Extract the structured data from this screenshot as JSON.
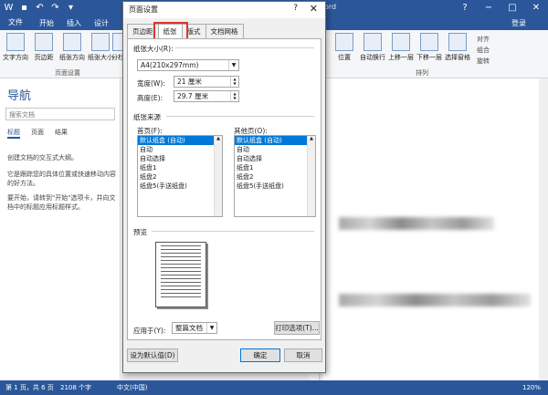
{
  "titlebar": {
    "qat_icons": [
      "word-logo-icon",
      "save-icon",
      "undo-icon",
      "redo-icon",
      "customize-icon"
    ],
    "right_text": "ord",
    "help": "?",
    "minimize": "−",
    "restore": "□",
    "close": "✕"
  },
  "ribbon_tabs": {
    "file": "文件",
    "home": "开始",
    "insert": "插入",
    "design": "设计",
    "login": "登录"
  },
  "ribbon": {
    "buttons": [
      "文字方向",
      "页边距",
      "纸张方向",
      "纸张大小",
      "分栏"
    ],
    "group_page_setup": "页面设置",
    "arrange_buttons": [
      "位置",
      "自动换行",
      "上移一层",
      "下移一层",
      "选择窗格"
    ],
    "arrange_small": [
      "对齐",
      "组合",
      "旋转"
    ],
    "group_arrange": "排列"
  },
  "nav": {
    "title": "导航",
    "search_placeholder": "搜索文档",
    "tabs": [
      "标题",
      "页面",
      "结果"
    ],
    "p1": "创建文档的交互式大纲。",
    "p2": "它是跟踪您的具体位置或快速移动内容的好方法。",
    "p3": "要开始，请转到\"开始\"选项卡，并向文档中的标题应用标题样式。"
  },
  "status": {
    "page": "第 1 页，共 6 页",
    "words": "2108 个字",
    "lang": "中文(中国)",
    "zoom": "120%"
  },
  "dialog": {
    "title": "页面设置",
    "help": "?",
    "close": "✕",
    "tabs": [
      "页边距",
      "纸张",
      "版式",
      "文档网格"
    ],
    "paper_size_label": "纸张大小(R):",
    "paper_size_value": "A4(210x297mm)",
    "width_label": "宽度(W):",
    "width_value": "21 厘米",
    "height_label": "高度(E):",
    "height_value": "29.7 厘米",
    "paper_source_label": "纸张来源",
    "first_page_label": "首页(F):",
    "other_pages_label": "其他页(O):",
    "first_page_items": [
      "默认纸盒 (自动)",
      "自动",
      "自动选择",
      "纸盘1",
      "纸盘2",
      "纸盘5(手送纸盘)"
    ],
    "other_pages_items": [
      "默认纸盒 (自动)",
      "自动",
      "自动选择",
      "纸盘1",
      "纸盘2",
      "纸盘5(手送纸盘)"
    ],
    "preview_label": "预览",
    "apply_to_label": "应用于(Y):",
    "apply_to_value": "整篇文档",
    "print_options": "打印选项(T)...",
    "set_default": "设为默认值(D)",
    "ok": "确定",
    "cancel": "取消"
  },
  "colors": {
    "word_blue": "#2b579a",
    "highlight_red": "#e0342f",
    "selection_blue": "#0078d7"
  }
}
